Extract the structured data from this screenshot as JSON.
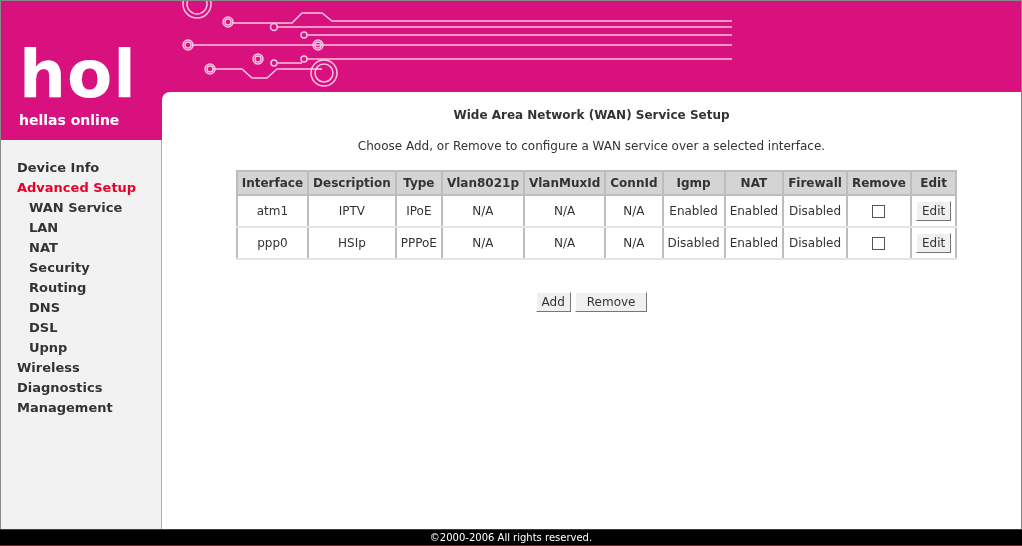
{
  "logo": {
    "mark": "hol",
    "tagline": "hellas online"
  },
  "sidebar": {
    "items": [
      {
        "label": "Device Info",
        "selected": false
      },
      {
        "label": "Advanced Setup",
        "selected": true,
        "children": [
          {
            "label": "WAN Service",
            "selected": false
          },
          {
            "label": "LAN",
            "selected": false
          },
          {
            "label": "NAT",
            "selected": false
          },
          {
            "label": "Security",
            "selected": false
          },
          {
            "label": "Routing",
            "selected": false
          },
          {
            "label": "DNS",
            "selected": false
          },
          {
            "label": "DSL",
            "selected": false
          },
          {
            "label": "Upnp",
            "selected": false
          }
        ]
      },
      {
        "label": "Wireless",
        "selected": false
      },
      {
        "label": "Diagnostics",
        "selected": false
      },
      {
        "label": "Management",
        "selected": false
      }
    ]
  },
  "title": "Wide Area Network (WAN) Service Setup",
  "instructions": "Choose Add, or Remove to configure a WAN service over a selected interface.",
  "table": {
    "columns": [
      "Interface",
      "Description",
      "Type",
      "Vlan8021p",
      "VlanMuxId",
      "ConnId",
      "Igmp",
      "NAT",
      "Firewall",
      "Remove",
      "Edit"
    ],
    "rows": [
      {
        "cells": [
          "atm1",
          "IPTV",
          "IPoE",
          "N/A",
          "N/A",
          "N/A",
          "Enabled",
          "Enabled",
          "Disabled"
        ],
        "remove_checked": false,
        "edit": "Edit"
      },
      {
        "cells": [
          "ppp0",
          "HSIp",
          "PPPoE",
          "N/A",
          "N/A",
          "N/A",
          "Disabled",
          "Enabled",
          "Disabled"
        ],
        "remove_checked": false,
        "edit": "Edit"
      }
    ]
  },
  "buttons": [
    "Add",
    "Remove"
  ],
  "footer": "©2000-2006 All rights reserved."
}
